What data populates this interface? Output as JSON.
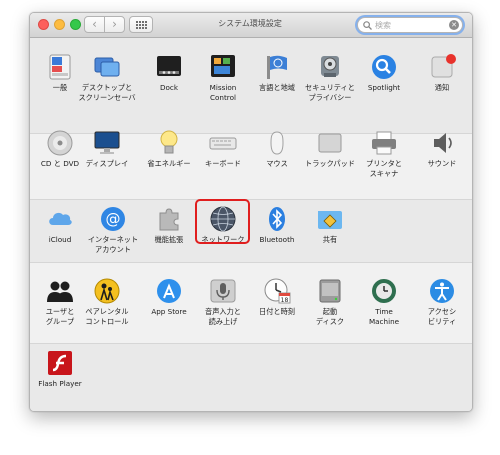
{
  "window": {
    "title": "システム環境設定"
  },
  "search": {
    "placeholder": "検索"
  },
  "colors": {
    "highlight": "#e01e1e",
    "accent": "#1e7ae0"
  },
  "rows": [
    [
      {
        "id": "general",
        "label": "一般",
        "icon": "general-icon"
      },
      {
        "id": "desktop",
        "label": "デスクトップと\nスクリーンセーバ",
        "icon": "desktop-screensaver-icon"
      },
      {
        "id": "dock",
        "label": "Dock",
        "icon": "dock-icon"
      },
      {
        "id": "mission",
        "label": "Mission\nControl",
        "icon": "mission-control-icon"
      },
      {
        "id": "language",
        "label": "言語と地域",
        "icon": "language-region-icon"
      },
      {
        "id": "security",
        "label": "セキュリティと\nプライバシー",
        "icon": "security-privacy-icon"
      },
      {
        "id": "spotlight",
        "label": "Spotlight",
        "icon": "spotlight-icon"
      },
      {
        "id": "notify",
        "label": "通知",
        "icon": "notifications-icon"
      }
    ],
    [
      {
        "id": "cddvd",
        "label": "CD と DVD",
        "icon": "cd-dvd-icon"
      },
      {
        "id": "display",
        "label": "ディスプレイ",
        "icon": "display-icon"
      },
      {
        "id": "energy",
        "label": "省エネルギー",
        "icon": "energy-saver-icon"
      },
      {
        "id": "keyboard",
        "label": "キーボード",
        "icon": "keyboard-icon"
      },
      {
        "id": "mouse",
        "label": "マウス",
        "icon": "mouse-icon"
      },
      {
        "id": "trackpad",
        "label": "トラックパッド",
        "icon": "trackpad-icon"
      },
      {
        "id": "printer",
        "label": "プリンタと\nスキャナ",
        "icon": "printer-scanner-icon"
      },
      {
        "id": "sound",
        "label": "サウンド",
        "icon": "sound-icon"
      }
    ],
    [
      {
        "id": "icloud",
        "label": "iCloud",
        "icon": "icloud-icon"
      },
      {
        "id": "internet",
        "label": "インターネット\nアカウント",
        "icon": "internet-accounts-icon"
      },
      {
        "id": "extensions",
        "label": "機能拡張",
        "icon": "extensions-icon"
      },
      {
        "id": "network",
        "label": "ネットワーク",
        "icon": "network-icon"
      },
      {
        "id": "bluetooth",
        "label": "Bluetooth",
        "icon": "bluetooth-icon"
      },
      {
        "id": "sharing",
        "label": "共有",
        "icon": "sharing-icon"
      }
    ],
    [
      {
        "id": "users",
        "label": "ユーザと\nグループ",
        "icon": "users-groups-icon"
      },
      {
        "id": "parental",
        "label": "ペアレンタル\nコントロール",
        "icon": "parental-controls-icon"
      },
      {
        "id": "appstore",
        "label": "App Store",
        "icon": "app-store-icon"
      },
      {
        "id": "dictation",
        "label": "音声入力と\n読み上げ",
        "icon": "dictation-speech-icon"
      },
      {
        "id": "datetime",
        "label": "日付と時刻",
        "icon": "date-time-icon"
      },
      {
        "id": "startup",
        "label": "起動\nディスク",
        "icon": "startup-disk-icon"
      },
      {
        "id": "timemachine",
        "label": "Time\nMachine",
        "icon": "time-machine-icon"
      },
      {
        "id": "access",
        "label": "アクセシ\nビリティ",
        "icon": "accessibility-icon"
      }
    ],
    [
      {
        "id": "flash",
        "label": "Flash Player",
        "icon": "flash-player-icon"
      }
    ]
  ]
}
